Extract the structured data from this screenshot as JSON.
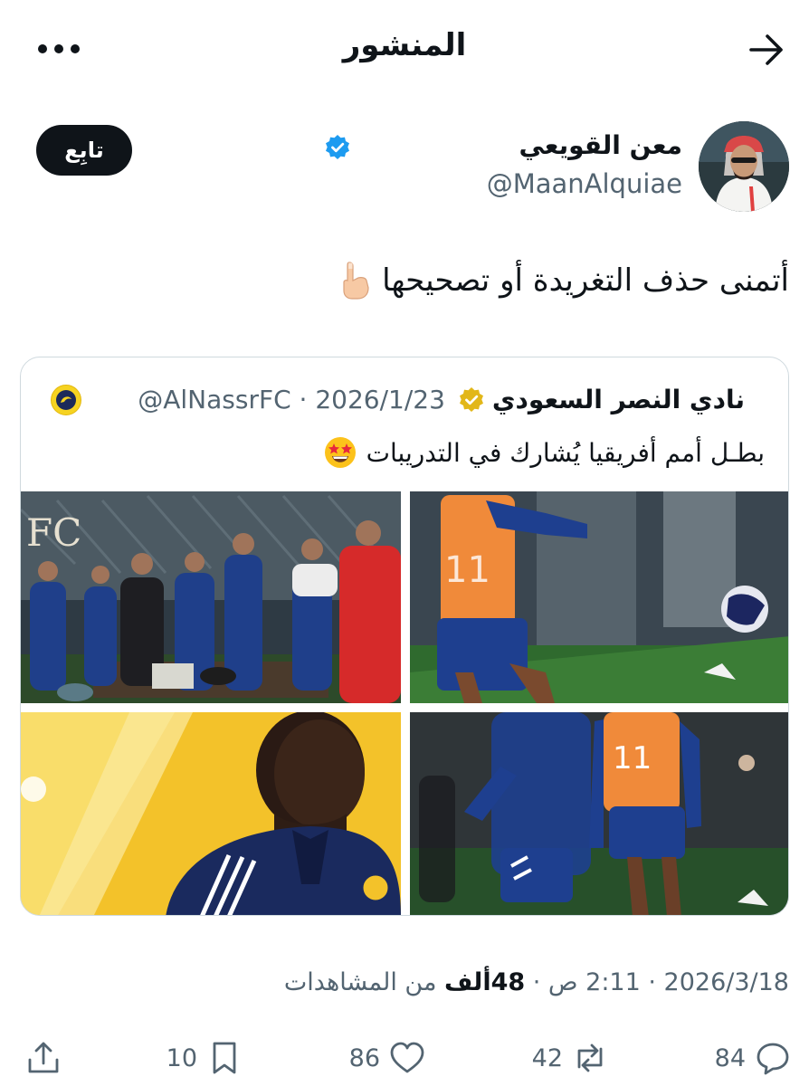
{
  "header": {
    "title": "المنشور"
  },
  "author": {
    "name": "معن القويعي",
    "handle": "@MaanAlquiae",
    "follow_label": "تابِع"
  },
  "post": {
    "text": "أتمنى حذف التغريدة أو تصحيحها",
    "timestamp_prefix": "2026/3/18 · 2:11 ص · ",
    "views_count": "48ألف",
    "views_suffix": " من المشاهدات"
  },
  "quoted": {
    "name": "نادي النصر السعودي",
    "meta": "@AlNassrFC · 2026/1/23",
    "text": "بطـل أمم أفريقيا يُشارك في التدريبات"
  },
  "actions": {
    "replies": "84",
    "reposts": "42",
    "likes": "86",
    "bookmarks": "10"
  },
  "colors": {
    "primary_text": "#0f1419",
    "secondary_text": "#536471",
    "verified_blue": "#1d9bf0",
    "verified_gold": "#e2b719",
    "border": "#cfd9de"
  },
  "icons": [
    "back-arrow-icon",
    "more-icon",
    "verified-badge-icon",
    "pointing-down-emoji",
    "star-struck-emoji",
    "reply-icon",
    "repost-icon",
    "like-icon",
    "bookmark-icon",
    "share-icon"
  ]
}
